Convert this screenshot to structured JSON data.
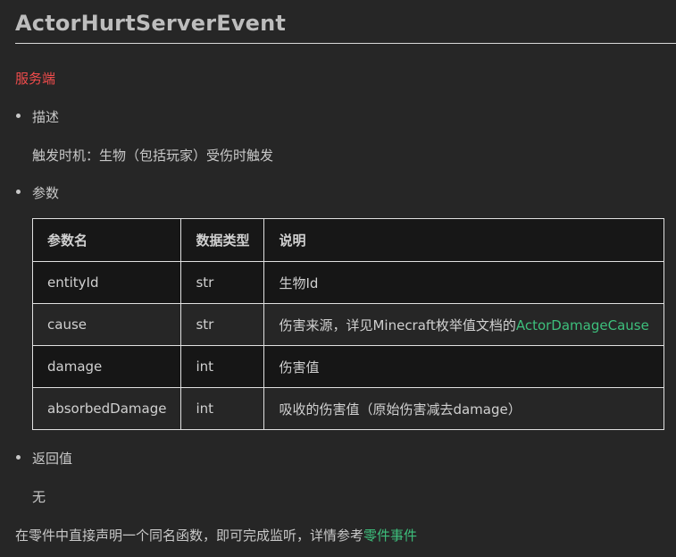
{
  "header": {
    "title": "ActorHurtServerEvent"
  },
  "server_tag": "服务端",
  "sections": {
    "description": {
      "label": "描述",
      "text": "触发时机：生物（包括玩家）受伤时触发"
    },
    "params": {
      "label": "参数",
      "columns": [
        "参数名",
        "数据类型",
        "说明"
      ],
      "rows": [
        {
          "name": "entityId",
          "type": "str",
          "desc": "生物Id",
          "link": ""
        },
        {
          "name": "cause",
          "type": "str",
          "desc": "伤害来源，详见Minecraft枚举值文档的",
          "link": "ActorDamageCause"
        },
        {
          "name": "damage",
          "type": "int",
          "desc": "伤害值",
          "link": ""
        },
        {
          "name": "absorbedDamage",
          "type": "int",
          "desc": "吸收的伤害值（原始伤害减去damage）",
          "link": ""
        }
      ]
    },
    "returns": {
      "label": "返回值",
      "text": "无"
    }
  },
  "footer": {
    "text": "在零件中直接声明一个同名函数，即可完成监听，详情参考",
    "link": "零件事件"
  },
  "colors": {
    "background": "#262626",
    "server_tag": "#f14c4c",
    "link": "#3dbf7c"
  }
}
